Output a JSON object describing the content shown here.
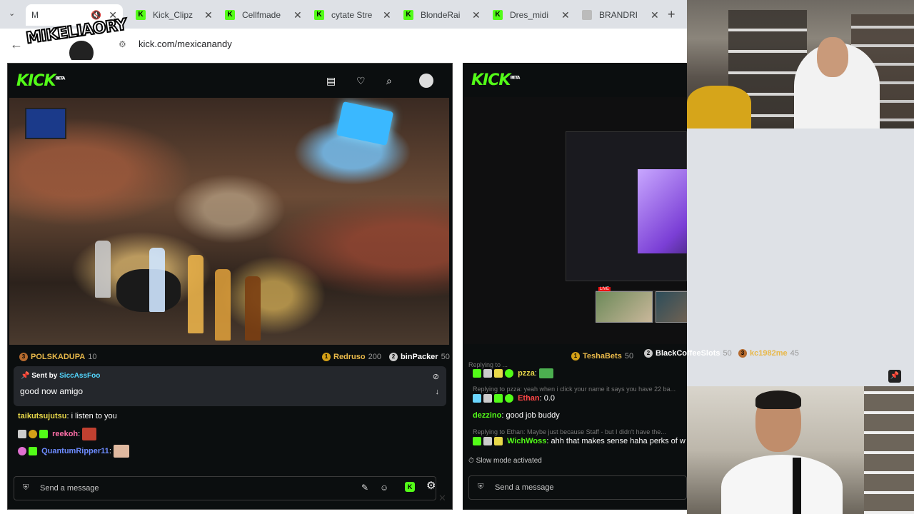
{
  "browser": {
    "tabs": [
      {
        "title": "M",
        "active": true
      },
      {
        "title": "Kick_Clipz"
      },
      {
        "title": "Cellfmade"
      },
      {
        "title": "cytate Stre"
      },
      {
        "title": "BlondeRai"
      },
      {
        "title": "Dres_midi"
      },
      {
        "title": "BRANDRI"
      }
    ],
    "new_tab": "+",
    "url": "kick.com/mexicanandy"
  },
  "overlay": {
    "logo_text": "MIKELIAORY"
  },
  "left": {
    "brand": "KICK",
    "beta": "BETA",
    "leaderboard": [
      {
        "rank": "3",
        "name": "POLSKADUPA",
        "count": "10"
      },
      {
        "rank": "1",
        "name": "Redruso",
        "count": "200"
      },
      {
        "rank": "2",
        "name": "binPacker",
        "count": "50"
      }
    ],
    "pinned": {
      "label": "Sent by",
      "user": "SiccAssFoo",
      "message": "good now amigo"
    },
    "chat": [
      {
        "user": "taikutsujutsu",
        "text": "i listen to you"
      },
      {
        "user": "reekoh",
        "text": ""
      },
      {
        "user": "QuantumRipper11",
        "text": ""
      }
    ],
    "send_placeholder": "Send a message"
  },
  "right": {
    "brand": "KICK",
    "beta": "BETA",
    "live": "LIVE",
    "leaderboard": [
      {
        "rank": "1",
        "name": "TeshaBets",
        "count": "50"
      },
      {
        "rank": "2",
        "name": "BlackCoffeeSlots",
        "count": "50"
      },
      {
        "rank": "3",
        "name": "kc1982me",
        "count": "45"
      }
    ],
    "chat": [
      {
        "reply": "Replying to ..."
      },
      {
        "user": "pzza",
        "text": ""
      },
      {
        "reply": "Replying to pzza: yeah when i click your name it says you have 22 ba..."
      },
      {
        "user": "Ethan",
        "text": "0.0"
      },
      {
        "user": "dezzino",
        "text": "good job buddy"
      },
      {
        "reply": "Replying to Ethan: Maybe just because Staff - but I didn't have the..."
      },
      {
        "user": "WichWoss",
        "text": "ahh that makes sense haha perks of w"
      }
    ],
    "slow_mode": "Slow mode activated",
    "send_placeholder": "Send a message"
  },
  "colors": {
    "kick_green": "#53fc18",
    "panel_bg": "#0b0e0f"
  },
  "icons": [
    "back-arrow-icon",
    "search-icon",
    "heart-icon",
    "clip-icon",
    "pin-icon",
    "emote-icon",
    "settings-icon",
    "close-icon"
  ]
}
